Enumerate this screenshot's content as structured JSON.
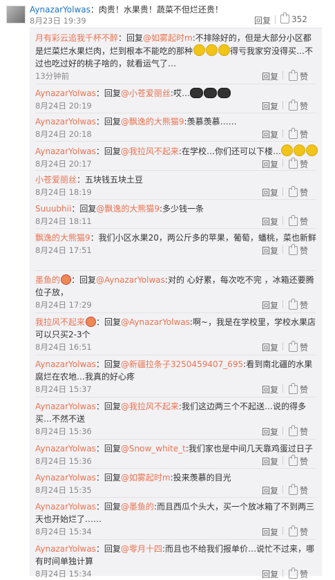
{
  "top": {
    "author": "AynazarYolwas",
    "text": "：肉贵！水果贵！蔬菜不但烂还贵！",
    "time": "8月23日 19:39",
    "reply": "回复",
    "likes": "352"
  },
  "labels": {
    "reply": "回复",
    "like": "赞",
    "reply_prefix": "：回复"
  },
  "comments": [
    {
      "author": "月有彩云追我千杯不醉",
      "mention": "@如雾起时m",
      "text": ":不排除好的，但是大部分小区都是烂菜烂水果烂肉，烂到根本不能吃的那种",
      "tail": "得亏我家穷没得买…不过也吃过好的桃子啥的，就看运气了…",
      "time": "13分钟前"
    },
    {
      "author": "AynazarYolwas",
      "mention": "@小苍爱丽丝",
      "text": ":哎…",
      "time": "8月24日 20:19"
    },
    {
      "author": "AynazarYolwas",
      "mention": "@飘逸的大熊猫9",
      "text": ":羡慕羡慕……",
      "time": "8月24日 20:18"
    },
    {
      "author": "AynazarYolwas",
      "mention": "@我拉风不起来",
      "text": ":在学校…你们还可以下楼…",
      "time": "8月24日 20:17"
    },
    {
      "author": "小苍爱丽丝",
      "text": "：五块钱五块土豆",
      "time": "8月24日 18:19"
    },
    {
      "author": "Suuubhii",
      "mention": "@飘逸的大熊猫9",
      "text": ":多少钱一条",
      "time": "8月24日 18:11"
    },
    {
      "author": "飘逸的大熊猫9",
      "text": "：我们小区水果20，两公斤多的苹果，葡萄，蟠桃，菜也新鲜",
      "time": "8月24日 17:51"
    },
    {
      "author": "墨鱼的",
      "mention": "@AynazarYolwas",
      "text": ":对的 心好累，每次吃不完 ，冰箱还要腾位子放，",
      "time": "8月24日 17:29"
    },
    {
      "author": "我拉风不起来",
      "mention": "@AynazarYolwas",
      "text": ":啊~，我是在学校里，学校水果店可以只买2-3个",
      "time": "8月24日 16:51"
    },
    {
      "author": "AynazarYolwas",
      "mention": "@新疆拉条子3250459407_695",
      "text": ":看到南北疆的水果腐烂在农地…我真的好心疼",
      "time": "8月24日 15:37"
    },
    {
      "author": "AynazarYolwas",
      "mention": "@我拉风不起来",
      "text": ":我们这边两三个不起送…说的得多买…不然不送",
      "time": "8月24日 15:36"
    },
    {
      "author": "AynazarYolwas",
      "mention": "@Snow_white_t",
      "text": ":我们家也是中间几天靠鸡蛋过日子",
      "time": "8月24日 15:36"
    },
    {
      "author": "AynazarYolwas",
      "mention": "@如雾起时m",
      "text": ":投来羡慕的目光",
      "time": "8月24日 15:35"
    },
    {
      "author": "AynazarYolwas",
      "mention": "@墨鱼的",
      "text": ":而且西瓜个头大，买一个放冰箱了不到两三天也开始烂了……",
      "time": "8月24日 15:34"
    },
    {
      "author": "AynazarYolwas",
      "mention": "@零月十四",
      "text": ":而且也不给我们报单价…说忙不过来，哪有时间单独计算",
      "time": "8月24日 15:34"
    }
  ]
}
